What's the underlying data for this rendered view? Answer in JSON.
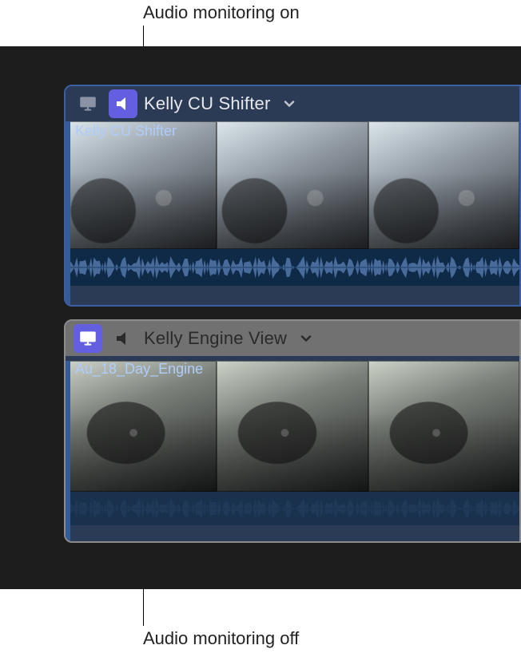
{
  "callouts": {
    "top": "Audio monitoring on",
    "bottom": "Audio monitoring off"
  },
  "angles": [
    {
      "id": "angle-1",
      "title": "Kelly CU Shifter",
      "clip_name": "Kelly CU Shifter",
      "video_monitor_active": false,
      "audio_monitor_active": true,
      "selected": true,
      "frame_style": "interior",
      "frame_count": 3,
      "has_waveform": true
    },
    {
      "id": "angle-2",
      "title": "Kelly Engine View",
      "clip_name": "Au_18_Day_Engine",
      "video_monitor_active": true,
      "audio_monitor_active": false,
      "selected": false,
      "frame_style": "car",
      "frame_count": 3,
      "has_waveform": true
    }
  ],
  "icons": {
    "video": "monitor-icon",
    "audio": "speaker-icon",
    "chevron": "chevron-down-icon"
  }
}
